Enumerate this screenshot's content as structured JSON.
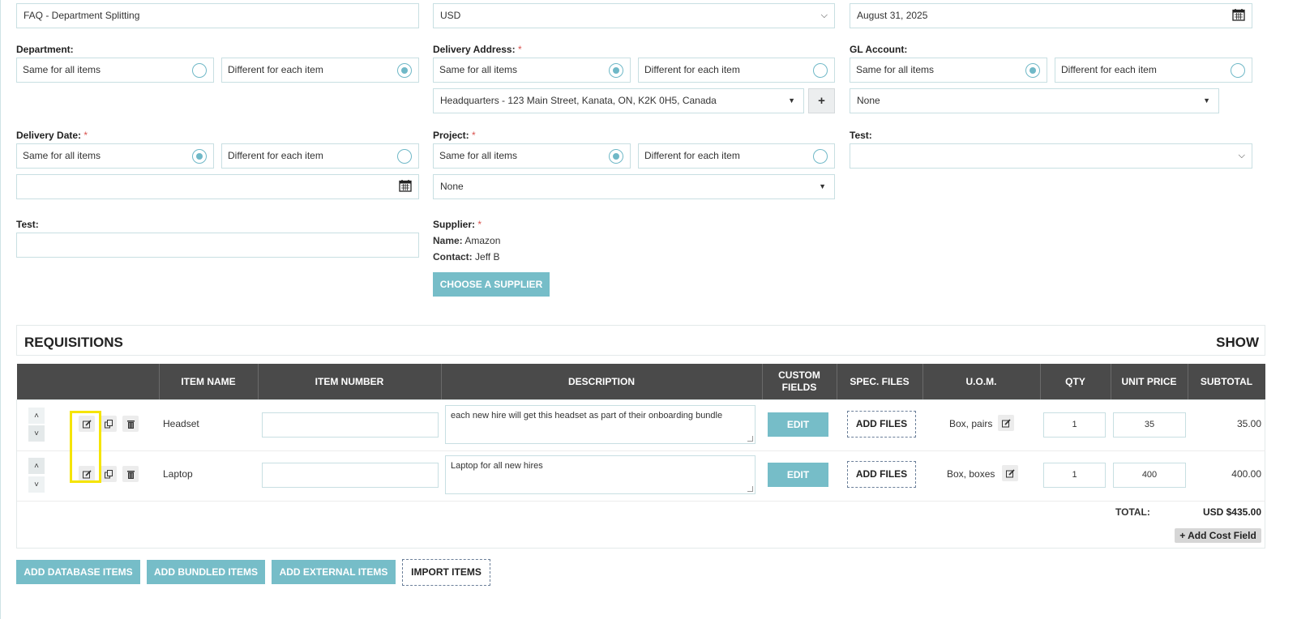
{
  "top": {
    "title_value": "FAQ - Department Splitting",
    "currency_value": "USD",
    "date_value": "August 31, 2025"
  },
  "department": {
    "label": "Department:",
    "opt_same": "Same for all items",
    "opt_diff": "Different for each item",
    "selected": "diff"
  },
  "delivery_address": {
    "label": "Delivery Address:",
    "required": "*",
    "opt_same": "Same for all items",
    "opt_diff": "Different for each item",
    "address_value": "Headquarters - 123 Main Street, Kanata, ON, K2K 0H5, Canada",
    "add_symbol": "+"
  },
  "gl_account": {
    "label": "GL Account:",
    "opt_same": "Same for all items",
    "opt_diff": "Different for each item",
    "value": "None"
  },
  "delivery_date": {
    "label": "Delivery Date:",
    "required": "*",
    "opt_same": "Same for all items",
    "opt_diff": "Different for each item",
    "value": ""
  },
  "project": {
    "label": "Project:",
    "required": "*",
    "opt_same": "Same for all items",
    "opt_diff": "Different for each item",
    "value": "None"
  },
  "test_select": {
    "label": "Test:",
    "value": ""
  },
  "test_input": {
    "label": "Test:",
    "value": ""
  },
  "supplier": {
    "label": "Supplier:",
    "required": "*",
    "name_label": "Name:",
    "name_value": "Amazon",
    "contact_label": "Contact:",
    "contact_value": "Jeff B",
    "choose_button": "CHOOSE A SUPPLIER"
  },
  "requisitions": {
    "title": "REQUISITIONS",
    "show_label": "SHOW",
    "columns": {
      "item_name": "ITEM NAME",
      "item_number": "ITEM NUMBER",
      "description": "DESCRIPTION",
      "custom_fields_1": "CUSTOM",
      "custom_fields_2": "FIELDS",
      "spec_files": "SPEC. FILES",
      "uom": "U.O.M.",
      "qty": "QTY",
      "unit_price": "UNIT PRICE",
      "subtotal": "SUBTOTAL"
    },
    "rows": [
      {
        "item_name": "Headset",
        "item_number": "",
        "description": "each new hire will get this headset as part of their onboarding bundle",
        "edit_button": "EDIT",
        "add_files_button": "ADD FILES",
        "uom": "Box, pairs",
        "qty": "1",
        "unit_price": "35",
        "subtotal": "35.00"
      },
      {
        "item_name": "Laptop",
        "item_number": "",
        "description": "Laptop for all new hires",
        "edit_button": "EDIT",
        "add_files_button": "ADD FILES",
        "uom": "Box, boxes",
        "qty": "1",
        "unit_price": "400",
        "subtotal": "400.00"
      }
    ],
    "total_label": "TOTAL:",
    "total_value": "USD $435.00",
    "add_cost_field": "Add Cost Field"
  },
  "bottom_buttons": {
    "add_database": "ADD DATABASE ITEMS",
    "add_bundled": "ADD BUNDLED ITEMS",
    "add_external": "ADD EXTERNAL ITEMS",
    "import": "IMPORT ITEMS"
  },
  "colors": {
    "accent_teal": "#76bdc8",
    "table_header": "#4a4a4a",
    "highlight": "#f5e400",
    "required": "#d9534f"
  }
}
